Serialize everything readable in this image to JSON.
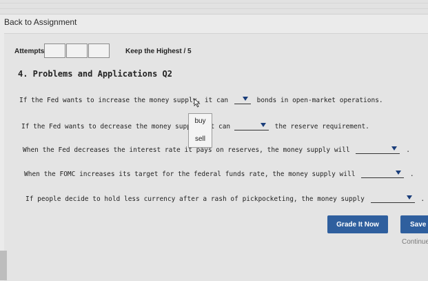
{
  "nav": {
    "back_label": "Back to Assignment"
  },
  "attempts": {
    "label": "Attempts",
    "keep_label": "Keep the Highest / 5"
  },
  "problem": {
    "title": "4. Problems and Applications Q2"
  },
  "questions": [
    {
      "before": "If the Fed wants to increase the money supply, it can",
      "after": "bonds in open-market operations."
    },
    {
      "before": "If the Fed wants to decrease the money supply, it can",
      "after": "the reserve requirement."
    },
    {
      "before": "When the Fed decreases the interest rate it pays on reserves, the money supply will",
      "after": "."
    },
    {
      "before": "When the FOMC increases its target for the federal funds rate, the money supply will",
      "after": "."
    },
    {
      "before": "If people decide to hold less currency after a rash of pickpocketing, the money supply",
      "after": "."
    }
  ],
  "dropdown": {
    "options": [
      "buy",
      "sell"
    ]
  },
  "actions": {
    "grade_label": "Grade It Now",
    "save_label": "Save",
    "continue_label": "Continue"
  }
}
